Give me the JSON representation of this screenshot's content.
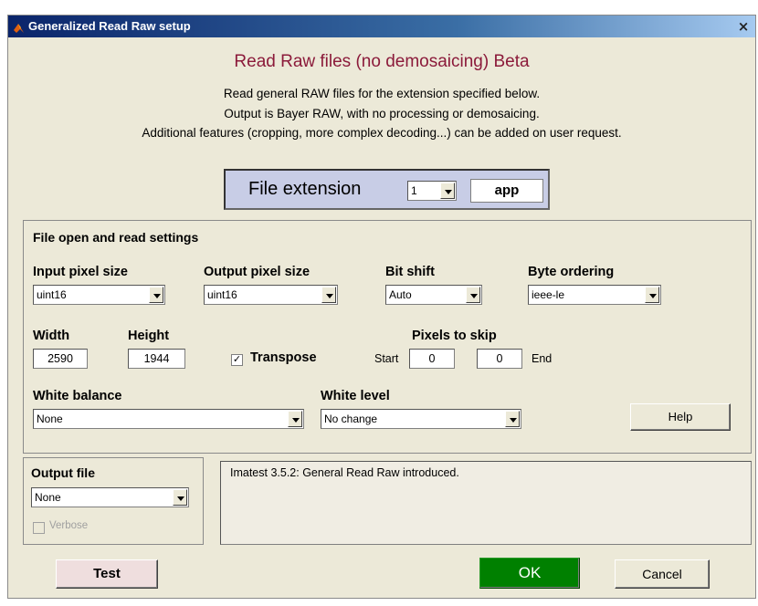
{
  "window": {
    "title": "Generalized Read Raw setup",
    "close_glyph": "×"
  },
  "header": {
    "heading": "Read Raw files (no demosaicing)  Beta",
    "desc_line1": "Read general RAW files for the extension specified below.",
    "desc_line2": "Output is Bayer RAW, with no processing or demosaicing.",
    "desc_line3": "Additional features (cropping, more complex decoding...) can be added on user request."
  },
  "extension": {
    "label": "File extension",
    "index": "1",
    "value": "app"
  },
  "settings": {
    "title": "File open and read settings",
    "input_pixel_size": {
      "label": "Input pixel size",
      "value": "uint16"
    },
    "output_pixel_size": {
      "label": "Output pixel size",
      "value": "uint16"
    },
    "bit_shift": {
      "label": "Bit shift",
      "value": "Auto"
    },
    "byte_ordering": {
      "label": "Byte ordering",
      "value": "ieee-le"
    },
    "width": {
      "label": "Width",
      "value": "2590"
    },
    "height": {
      "label": "Height",
      "value": "1944"
    },
    "transpose": {
      "label": "Transpose",
      "checked": true,
      "mark": "✓"
    },
    "pixels_to_skip": {
      "label": "Pixels to skip",
      "start_label": "Start",
      "start_value": "0",
      "end_value": "0",
      "end_label": "End"
    },
    "white_balance": {
      "label": "White balance",
      "value": "None"
    },
    "white_level": {
      "label": "White level",
      "value": "No change"
    },
    "help_label": "Help"
  },
  "output_file": {
    "title": "Output file",
    "value": "None",
    "verbose_label": "Verbose",
    "verbose_checked": false
  },
  "log": {
    "text": "Imatest 3.5.2: General Read Raw introduced."
  },
  "buttons": {
    "test": {
      "label": "Test",
      "color": "#efdede"
    },
    "ok": {
      "label": "OK",
      "color": "#008000"
    },
    "cancel": {
      "label": "Cancel"
    }
  },
  "colors": {
    "heading": "#8b1a3a",
    "extension_box": "#c8cde6",
    "titlebar": "#0a246a"
  },
  "icons": {
    "title": "matlab-icon"
  }
}
